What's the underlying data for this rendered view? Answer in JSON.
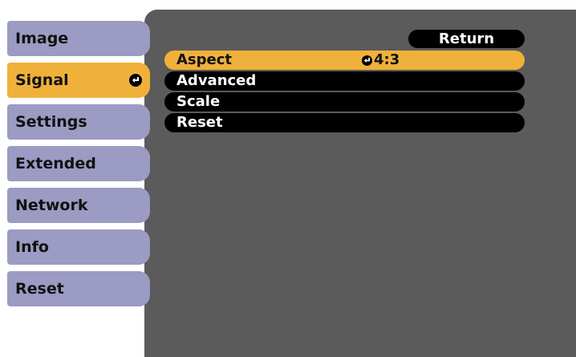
{
  "sidebar": {
    "items": [
      {
        "label": "Image"
      },
      {
        "label": "Signal"
      },
      {
        "label": "Settings"
      },
      {
        "label": "Extended"
      },
      {
        "label": "Network"
      },
      {
        "label": "Info"
      },
      {
        "label": "Reset"
      }
    ],
    "active_index": 1,
    "active_icon": "enter-icon"
  },
  "menu": {
    "return_label": "Return",
    "items": [
      {
        "label": "Aspect",
        "value": "4:3",
        "value_icon": "enter-icon"
      },
      {
        "label": "Advanced"
      },
      {
        "label": "Scale"
      },
      {
        "label": "Reset"
      }
    ],
    "active_index": 0
  },
  "colors": {
    "panel_bg": "#5b5b5b",
    "sidebar_item": "#9b9bc3",
    "highlight": "#f0b13a",
    "row_bg": "#000000"
  }
}
